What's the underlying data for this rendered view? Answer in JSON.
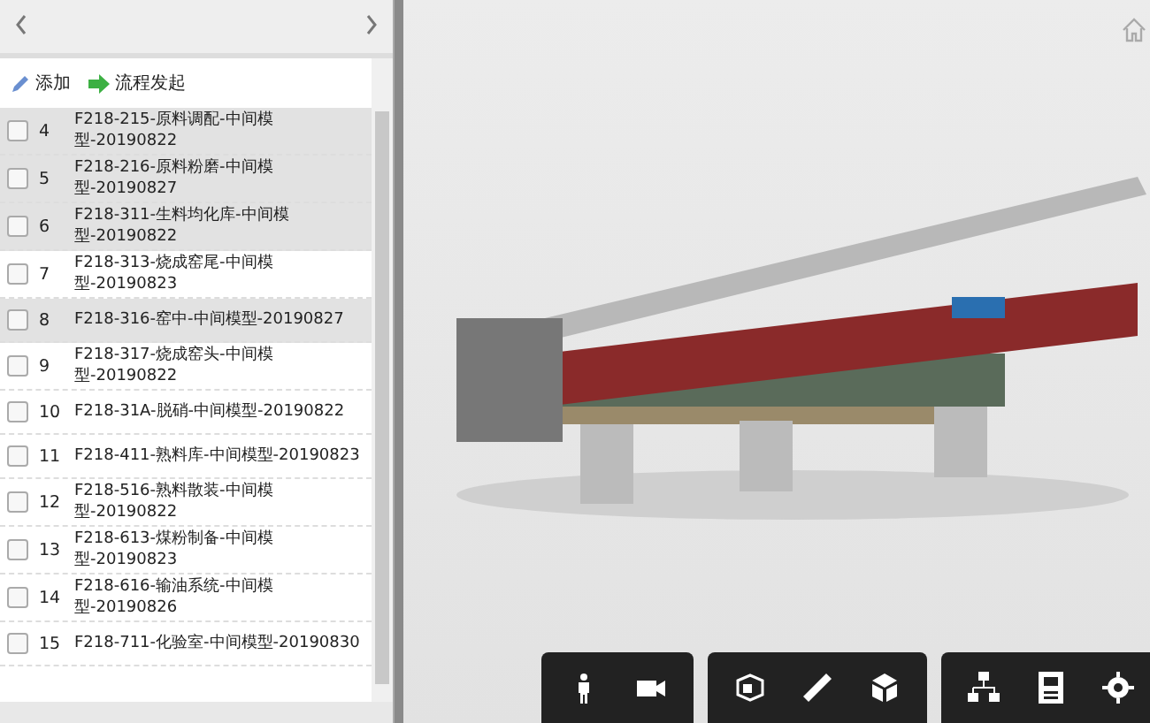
{
  "toolbar": {
    "add_label": "添加",
    "start_label": "流程发起"
  },
  "rows": [
    {
      "number": "4",
      "name": "F218-215-原料调配-中间模型-20190822",
      "checked": false,
      "selected": true
    },
    {
      "number": "5",
      "name": "F218-216-原料粉磨-中间模型-20190827",
      "checked": false,
      "selected": true
    },
    {
      "number": "6",
      "name": "F218-311-生料均化库-中间模型-20190822",
      "checked": false,
      "selected": true
    },
    {
      "number": "7",
      "name": "F218-313-烧成窑尾-中间模型-20190823",
      "checked": false,
      "selected": false
    },
    {
      "number": "8",
      "name": "F218-316-窑中-中间模型-20190827",
      "checked": false,
      "selected": true
    },
    {
      "number": "9",
      "name": "F218-317-烧成窑头-中间模型-20190822",
      "checked": false,
      "selected": false
    },
    {
      "number": "10",
      "name": "F218-31A-脱硝-中间模型-20190822",
      "checked": false,
      "selected": false
    },
    {
      "number": "11",
      "name": "F218-411-熟料库-中间模型-20190823",
      "checked": false,
      "selected": false
    },
    {
      "number": "12",
      "name": "F218-516-熟料散装-中间模型-20190822",
      "checked": false,
      "selected": false
    },
    {
      "number": "13",
      "name": "F218-613-煤粉制备-中间模型-20190823",
      "checked": false,
      "selected": false
    },
    {
      "number": "14",
      "name": "F218-616-输油系统-中间模型-20190826",
      "checked": false,
      "selected": false
    },
    {
      "number": "15",
      "name": "F218-711-化验室-中间模型-20190830",
      "checked": false,
      "selected": false
    }
  ]
}
